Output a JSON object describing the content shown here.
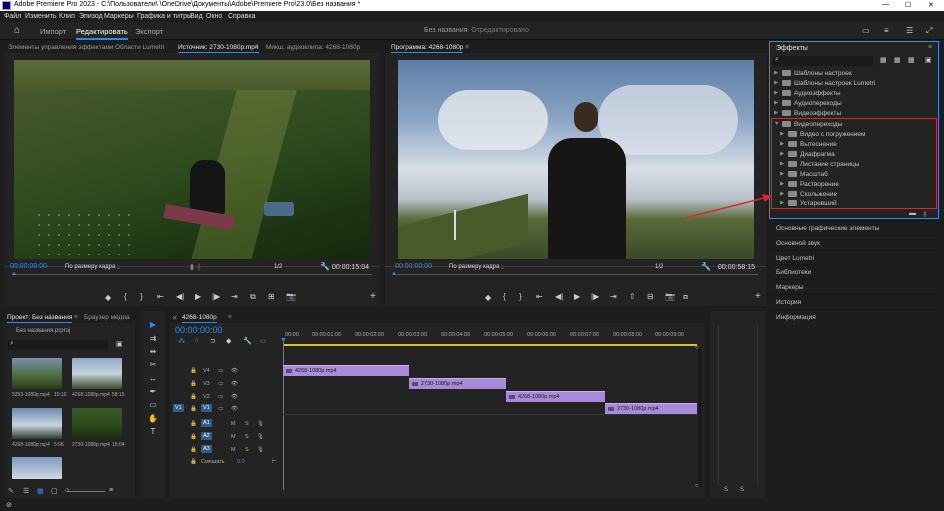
{
  "window": {
    "title": "Adobe Premiere Pro 2023 - C:\\Пользователи\\      \\OneDrive\\Документы\\Adobe\\Premiere Pro\\23.0\\Без названия *"
  },
  "menu": [
    "Файл",
    "Изменить",
    "Клип",
    "Эпизод",
    "Маркеры",
    "Графика и титры",
    "Вид",
    "Окно",
    "Справка"
  ],
  "header": {
    "tabs": [
      "Импорт",
      "Редактировать",
      "Экспорт"
    ],
    "project_name": "Без названия",
    "status": "- Отредактировано"
  },
  "source_panel": {
    "tabs": [
      "Элементы управления эффектами",
      "Области Lumetri",
      "Источник: 2730-1080p.mp4",
      "Микш. аудиоклипа: 4268-1080p"
    ],
    "timecode": "00:00:00:00",
    "fit": "По размеру кадра",
    "resolution": "1/2",
    "duration": "00:00:15:04"
  },
  "program_panel": {
    "title": "Программа: 4268-1080p",
    "timecode": "00:00:00:00",
    "fit": "По размеру кадра",
    "resolution": "1/2",
    "duration": "00:00:58:15"
  },
  "effects_panel": {
    "title": "Эффекты",
    "items": [
      "Шаблоны настроек",
      "Шаблоны настроек Lumetri",
      "Аудиоэффекты",
      "Аудиопереходы",
      "Видеоэффекты"
    ],
    "expanded": "Видеопереходы",
    "subitems": [
      "Видео с погружением",
      "Вытеснение",
      "Диафрагма",
      "Листание страницы",
      "Масштаб",
      "Растворение",
      "Скольжение",
      "Устаревший"
    ]
  },
  "side_sections": [
    "Основные графические элементы",
    "Основной звук",
    "Цвет Lumetri",
    "Библиотеки",
    "Маркеры",
    "История",
    "Информация"
  ],
  "project_panel": {
    "tabs": [
      "Проект: Без названия",
      "Браузер медиа"
    ],
    "file": "Без названия.prproj",
    "clips": [
      {
        "name": "5253-1080p.mp4",
        "dur": "15:10"
      },
      {
        "name": "4268-1080p.mp4",
        "dur": "58:15"
      },
      {
        "name": "4268-1080p.mp4",
        "dur": "5:06"
      },
      {
        "name": "2730-1080p.mp4",
        "dur": "15:04"
      },
      {
        "name": "",
        "dur": ""
      }
    ]
  },
  "timeline": {
    "tab": "4268-1080p",
    "timecode": "00:00:00:00",
    "ruler": [
      "00:00",
      "00:00:01:00",
      "00:00:02:00",
      "00:00:03:00",
      "00:00:04:00",
      "00:00:05:00",
      "00:00:06:00",
      "00:00:07:00",
      "00:00:08:00",
      "00:00:09:00"
    ],
    "video_tracks": [
      "V4",
      "V3",
      "V2",
      "V1"
    ],
    "audio_tracks": [
      "A1",
      "A2",
      "A3"
    ],
    "source_patch_v": "V1",
    "source_patch_a": "A1",
    "mix_label": "Смешать",
    "mix_value": "0.0",
    "clips": [
      {
        "name": "4268-1080p.mp4",
        "track": "V4"
      },
      {
        "name": "2730-1080p.mp4",
        "track": "V3"
      },
      {
        "name": "4268-1080p.mp4",
        "track": "V2"
      },
      {
        "name": "2730-1080p.mp4",
        "track": "V1"
      }
    ]
  },
  "audio_meter": {
    "labels": [
      "S",
      "S"
    ]
  },
  "colors": {
    "accent": "#2d8ceb",
    "clip": "#a78bd8",
    "highlight": "#e0262b",
    "playhead": "#2d8ceb"
  }
}
